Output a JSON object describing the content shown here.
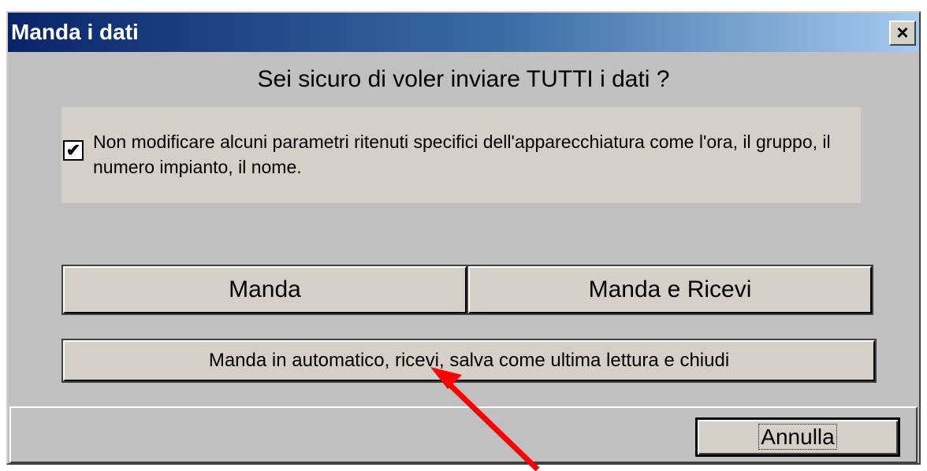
{
  "window": {
    "title": "Manda i dati",
    "close_label": "×"
  },
  "dialog": {
    "question": "Sei sicuro di voler inviare TUTTI i dati ?",
    "option": {
      "checked": true,
      "check_mark": "✔",
      "label": "Non modificare alcuni parametri ritenuti specifici dell'apparecchiatura come l'ora, il gruppo, il numero impianto, il nome."
    },
    "buttons": {
      "send": "Manda",
      "send_receive": "Manda e Ricevi",
      "auto": "Manda in automatico, ricevi, salva come ultima lettura e chiudi"
    }
  },
  "footer": {
    "cancel": "Annulla"
  },
  "colors": {
    "title_start": "#0a246a",
    "title_end": "#a6caf0",
    "arrow": "#ff0000"
  }
}
